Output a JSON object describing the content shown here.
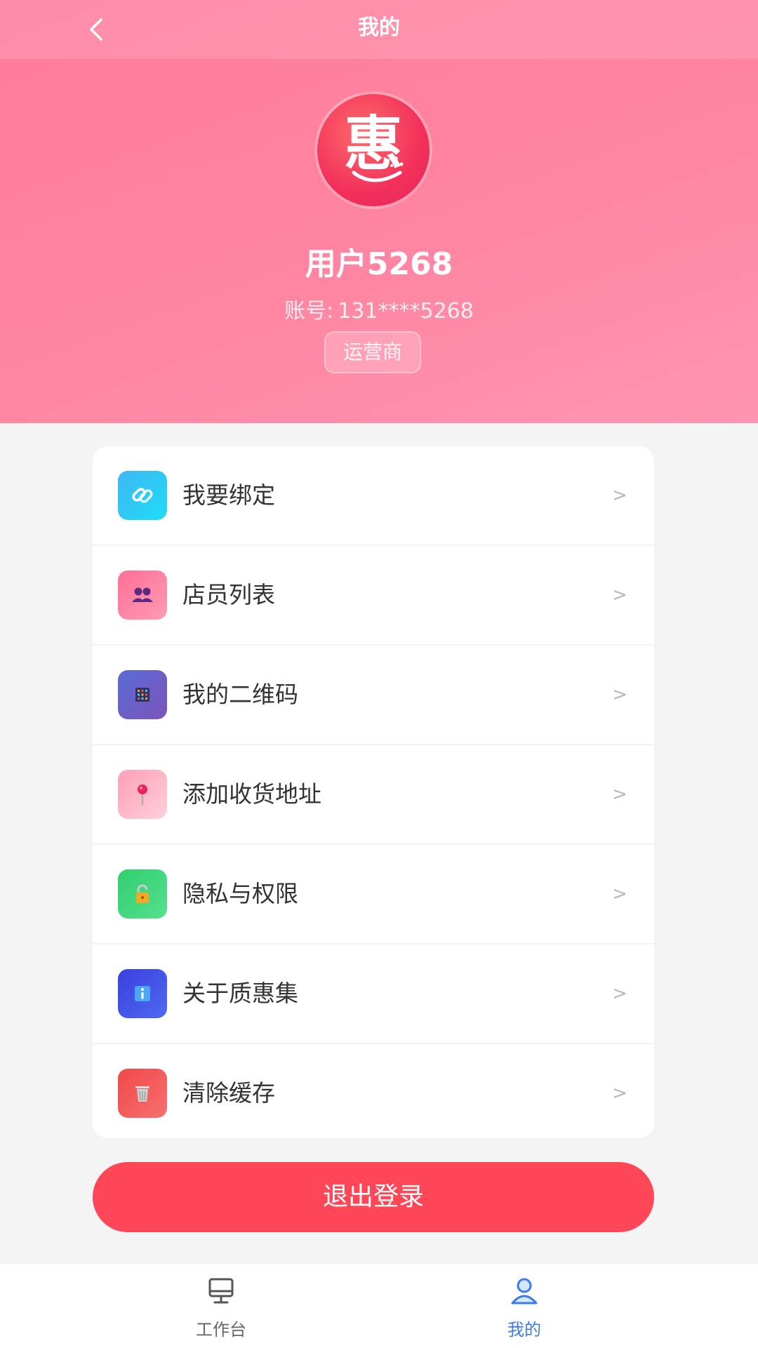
{
  "nav": {
    "title": "我的",
    "back_icon": "chevron-left-icon"
  },
  "profile": {
    "avatar_icon": "hui-logo-icon",
    "username": "用户5268",
    "account_label": "账号:",
    "account_value": "131****5268",
    "role": "运营商"
  },
  "menu": {
    "items": [
      {
        "label": "我要绑定",
        "icon": "link-icon",
        "color": "#2fc5f7",
        "arrow": ">"
      },
      {
        "label": "店员列表",
        "icon": "users-icon",
        "color": "#ff7fa0",
        "arrow": ">"
      },
      {
        "label": "我的二维码",
        "icon": "qrcode-icon",
        "color": "#6b5fc7",
        "arrow": ">"
      },
      {
        "label": "添加收货地址",
        "icon": "location-pin-icon",
        "color": "#ffb3c6",
        "arrow": ">"
      },
      {
        "label": "隐私与权限",
        "icon": "lock-icon",
        "color": "#3ecf7a",
        "arrow": ">"
      },
      {
        "label": "关于质惠集",
        "icon": "info-icon",
        "color": "#3d4fe0",
        "arrow": ">"
      },
      {
        "label": "清除缓存",
        "icon": "trash-icon",
        "color": "#f25a5a",
        "arrow": ">"
      }
    ]
  },
  "logout": {
    "label": "退出登录",
    "color": "#ff4757"
  },
  "tabbar": {
    "items": [
      {
        "label": "工作台",
        "icon": "monitor-icon",
        "active": false
      },
      {
        "label": "我的",
        "icon": "user-icon",
        "active": true
      }
    ],
    "active_color": "#3c7be8"
  },
  "colors": {
    "header_gradient_start": "#ff7a9b",
    "header_gradient_end": "#ff95b0",
    "background": "#f4f4f4"
  }
}
